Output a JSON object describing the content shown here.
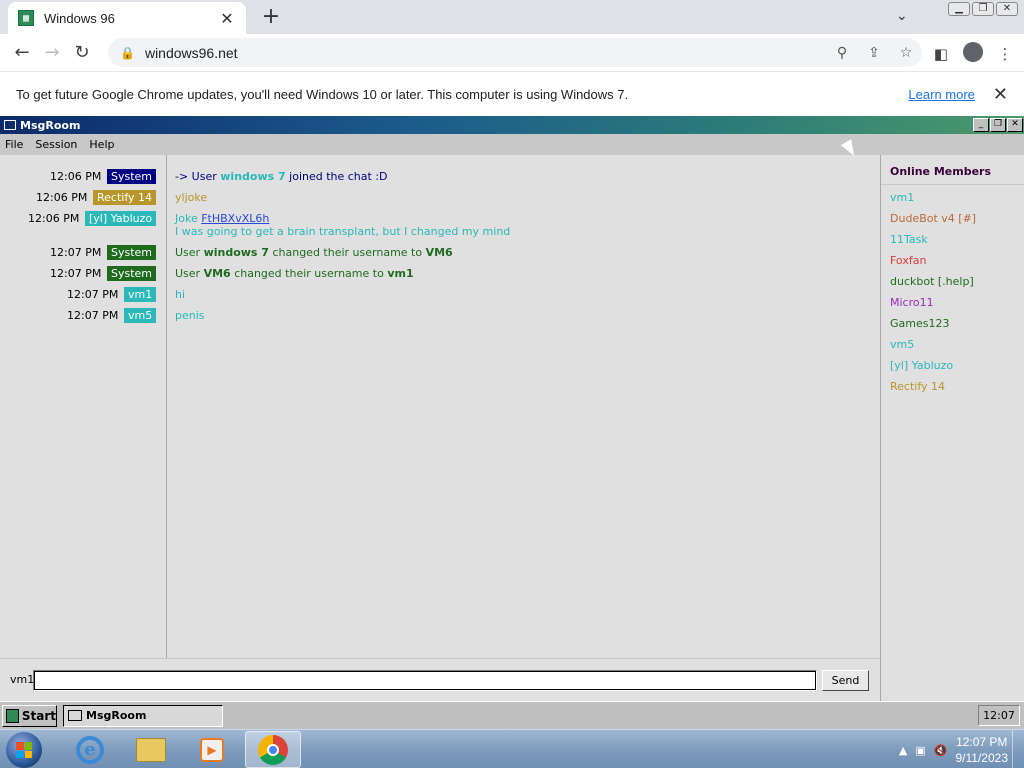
{
  "browser": {
    "tab_title": "Windows 96",
    "new_tab": "+",
    "tab_close": "✕",
    "url": "windows96.net"
  },
  "infobar": {
    "message": "To get future Google Chrome updates, you'll need Windows 10 or later. This computer is using Windows 7.",
    "link": "Learn more"
  },
  "app": {
    "title": "MsgRoom",
    "menu": [
      "File",
      "Session",
      "Help"
    ]
  },
  "messages": [
    {
      "time": "12:06 PM",
      "user": "System",
      "badge": "system-blue",
      "parts": [
        {
          "t": "-> User ",
          "c": "#000080"
        },
        {
          "t": "windows 7",
          "c": "#2ab8b8",
          "b": true
        },
        {
          "t": " joined the chat :D",
          "c": "#000080"
        }
      ]
    },
    {
      "time": "12:06 PM",
      "user": "Rectify 14",
      "badge": "rect",
      "parts": [
        {
          "t": "yljoke",
          "c": "#b8962a"
        }
      ]
    },
    {
      "time": "12:06 PM",
      "user": "[yl] Yabluzo",
      "badge": "yab",
      "parts": [
        {
          "t": "Joke ",
          "c": "#2ab8b8"
        },
        {
          "t": "FtHBXvXL6h",
          "c": "#2a4ad8",
          "u": true
        }
      ],
      "line2": "I was going to get a brain transplant, but I changed my mind"
    },
    {
      "time": "12:07 PM",
      "user": "System",
      "badge": "system",
      "parts": [
        {
          "t": "User ",
          "c": "#1e6b1e"
        },
        {
          "t": "windows 7",
          "c": "#1e6b1e",
          "b": true
        },
        {
          "t": " changed their username to ",
          "c": "#1e6b1e"
        },
        {
          "t": "VM6",
          "c": "#1e6b1e",
          "b": true
        }
      ]
    },
    {
      "time": "12:07 PM",
      "user": "System",
      "badge": "system",
      "parts": [
        {
          "t": "User ",
          "c": "#1e6b1e"
        },
        {
          "t": "VM6",
          "c": "#1e6b1e",
          "b": true
        },
        {
          "t": " changed their username to ",
          "c": "#1e6b1e"
        },
        {
          "t": "vm1",
          "c": "#1e6b1e",
          "b": true
        }
      ]
    },
    {
      "time": "12:07 PM",
      "user": "vm1",
      "badge": "vm",
      "parts": [
        {
          "t": "hi",
          "c": "#2ab8b8"
        }
      ]
    },
    {
      "time": "12:07 PM",
      "user": "vm5",
      "badge": "vm",
      "parts": [
        {
          "t": "penis",
          "c": "#2ab8b8"
        }
      ]
    }
  ],
  "members": {
    "heading": "Online Members",
    "list": [
      {
        "name": "vm1",
        "color": "#2ab8b8"
      },
      {
        "name": "DudeBot v4 [#]",
        "color": "#b86a3a"
      },
      {
        "name": "11Task",
        "color": "#2ab8b8"
      },
      {
        "name": "Foxfan",
        "color": "#d83a3a"
      },
      {
        "name": "duckbot [.help]",
        "color": "#1e6b1e"
      },
      {
        "name": "Micro11",
        "color": "#9a2ab8"
      },
      {
        "name": "Games123",
        "color": "#1e6b1e"
      },
      {
        "name": "vm5",
        "color": "#2ab8b8"
      },
      {
        "name": "[yl] Yabluzo",
        "color": "#2ab8b8"
      },
      {
        "name": "Rectify 14",
        "color": "#b8962a"
      }
    ]
  },
  "input": {
    "nick": "vm1",
    "value": "",
    "send": "Send"
  },
  "w96taskbar": {
    "start": "Start",
    "item": "MsgRoom",
    "clock": "12:07"
  },
  "w7taskbar": {
    "time": "12:07 PM",
    "date": "9/11/2023"
  }
}
